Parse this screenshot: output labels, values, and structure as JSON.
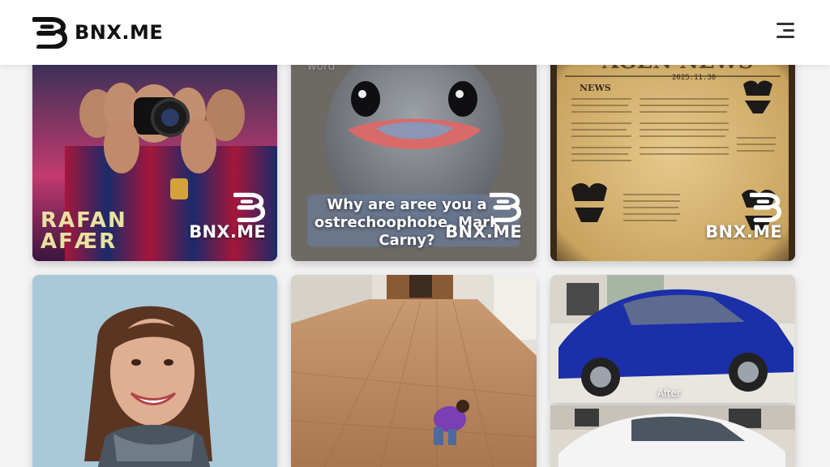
{
  "header": {
    "brand": "BNX.ME",
    "menu_icon": "hamburger-menu-icon"
  },
  "gallery": {
    "watermark": "BNX.ME",
    "cards": [
      {
        "id": "football-photographer",
        "overlay_text": "RAFAN AFÆR"
      },
      {
        "id": "ostrich",
        "overlay_text": "Why are aree you a ostrechoophobe, Mark Carny?",
        "faded_text": "word"
      },
      {
        "id": "newspaper",
        "headline": "AGEN NEWS",
        "date": "2025.11.30",
        "section": "NEWS"
      },
      {
        "id": "smiling-woman"
      },
      {
        "id": "wood-floor-room"
      },
      {
        "id": "blue-car",
        "label": "After"
      },
      {
        "id": "white-car"
      }
    ]
  },
  "colors": {
    "header_bg": "#ffffff",
    "page_bg": "#f3f3f3",
    "brand_text": "#111111"
  }
}
